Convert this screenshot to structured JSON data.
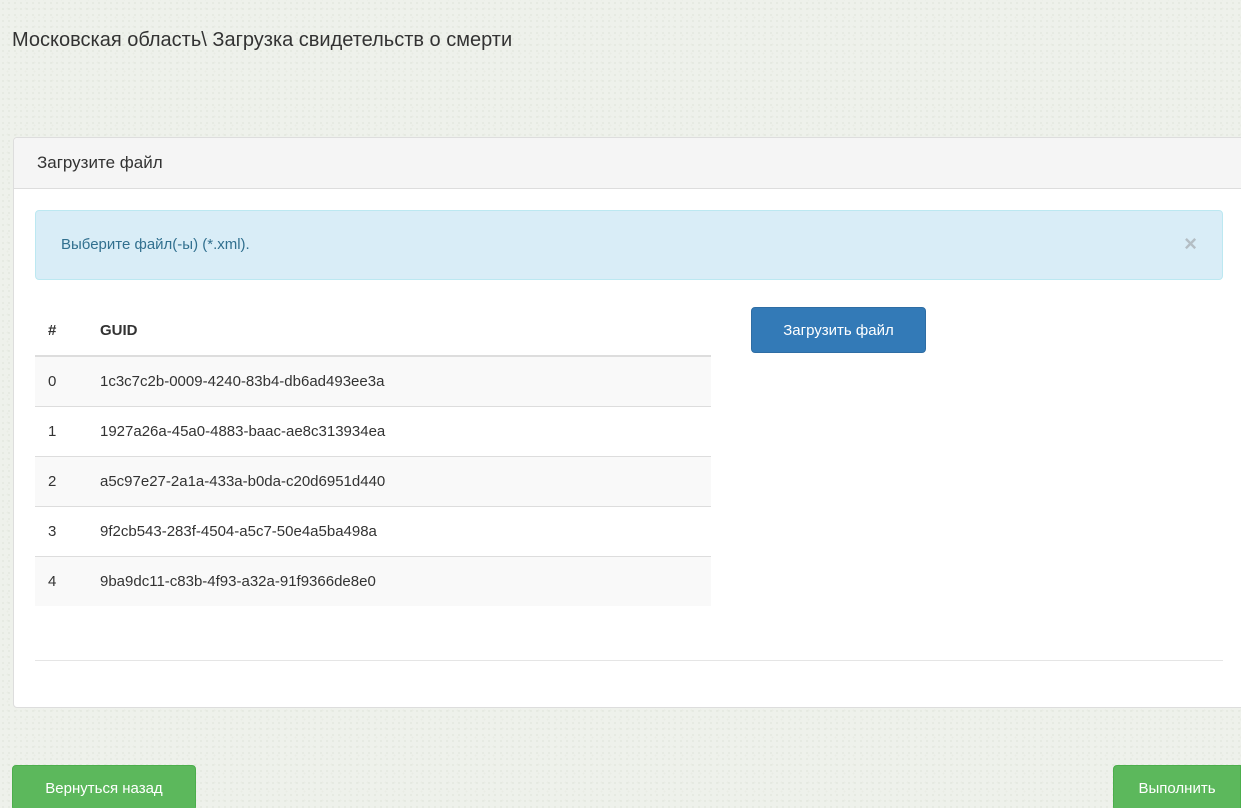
{
  "page": {
    "title": "Московская область\\ Загрузка свидетельств о смерти"
  },
  "panel": {
    "heading": "Загрузите файл",
    "alert": {
      "text": "Выберите файл(-ы) (*.xml).",
      "close": "×"
    },
    "upload_button": "Загрузить файл",
    "table": {
      "headers": [
        "#",
        "GUID"
      ],
      "rows": [
        [
          "0",
          "1c3c7c2b-0009-4240-83b4-db6ad493ee3a"
        ],
        [
          "1",
          "1927a26a-45a0-4883-baac-ae8c313934ea"
        ],
        [
          "2",
          "a5c97e27-2a1a-433a-b0da-c20d6951d440"
        ],
        [
          "3",
          "9f2cb543-283f-4504-a5c7-50e4a5ba498a"
        ],
        [
          "4",
          "9ba9dc11-c83b-4f93-a32a-91f9366de8e0"
        ]
      ]
    }
  },
  "footer": {
    "back_button": "Вернуться назад",
    "run_button": "Выполнить"
  },
  "colors": {
    "primary": "#337ab7",
    "success": "#5cb85c",
    "info_bg": "#d9edf7",
    "info_text": "#31708f"
  }
}
